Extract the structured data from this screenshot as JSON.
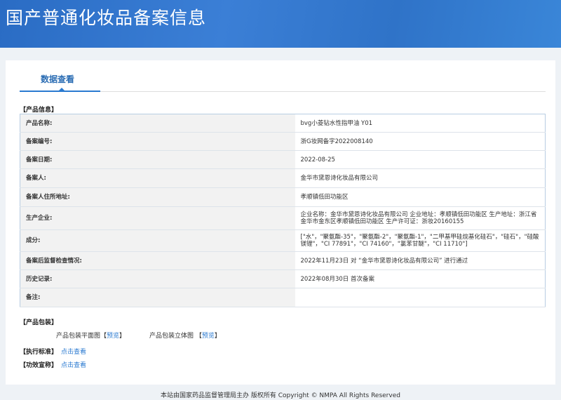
{
  "header": {
    "title": "国产普通化妆品备案信息"
  },
  "tab": {
    "label": "数据查看"
  },
  "product_info": {
    "section": "【产品信息】",
    "rows": [
      {
        "label": "产品名称:",
        "value": "bvg小菱钻水性指甲油 Y01"
      },
      {
        "label": "备案编号:",
        "value": "浙G妆网备字2022008140"
      },
      {
        "label": "备案日期:",
        "value": "2022-08-25"
      },
      {
        "label": "备案人:",
        "value": "金华市黛恩诗化妆品有限公司"
      },
      {
        "label": "备案人住所地址:",
        "value": "孝顺镇低田功能区"
      },
      {
        "label": "生产企业:",
        "value": "企业名称：金华市黛恩诗化妆品有限公司 企业地址：孝顺镇低田功能区 生产地址：浙江省金华市金东区孝顺镇低田功能区 生产许可证：浙妆20160155"
      },
      {
        "label": "成分:",
        "value": "[\"水\"，\"聚氨酯-35\"，\"聚氨酯-2\"，\"聚氨酯-1\"，\"二甲基甲硅烷基化硅石\"，\"硅石\"，\"硅酸镁锂\"，\"CI 77891\"，\"CI 74160\"，\"氯苯甘醚\"，\"CI 11710\"]"
      },
      {
        "label": "备案后监督检查情况:",
        "value": "2022年11月23日 对 “金华市黛恩诗化妆品有限公司” 进行通过"
      },
      {
        "label": "历史记录:",
        "value": "2022年08月30日 首次备案"
      },
      {
        "label": "备注:",
        "value": ""
      }
    ]
  },
  "packaging": {
    "section": "【产品包装】",
    "flat_label": "产品包装平面图",
    "solid_label": "产品包装立体图",
    "bracket_open": "【",
    "bracket_close": "】",
    "preview": "预览"
  },
  "standard": {
    "section": "【执行标准】",
    "link": "点击查看"
  },
  "efficacy": {
    "section": "【功效宣称】",
    "link": "点击查看"
  },
  "footer": {
    "text": "本站由国家药品监督管理局主办 版权所有 Copyright © NMPA All Rights Reserved"
  }
}
